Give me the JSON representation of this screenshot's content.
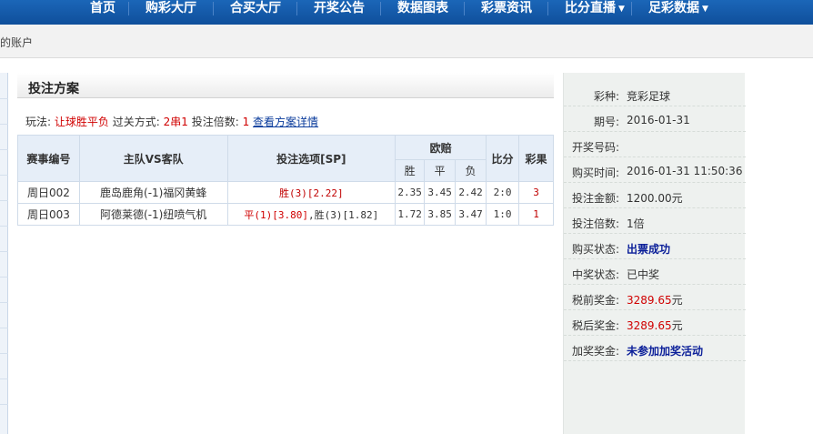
{
  "nav": {
    "items": [
      "首页",
      "购彩大厅",
      "合买大厅",
      "开奖公告",
      "数据图表",
      "彩票资讯",
      "比分直播",
      "足彩数据"
    ]
  },
  "breadcrumb": "的账户",
  "panel": {
    "title": "投注方案",
    "play_label": "玩法:",
    "play_value": "让球胜平负",
    "pass_label": "过关方式:",
    "pass_value": "2串1",
    "multiple_label": "投注倍数:",
    "multiple_value": "1",
    "detail_link": "查看方案详情"
  },
  "table": {
    "headers": {
      "match_no": "赛事编号",
      "teams": "主队VS客队",
      "option": "投注选项[SP]",
      "odds": "欧赔",
      "win": "胜",
      "draw": "平",
      "lose": "负",
      "score": "比分",
      "result": "彩果"
    },
    "rows": [
      {
        "match_no": "周日002",
        "teams": "鹿岛鹿角(-1)福冈黄蜂",
        "option": "胜(3)[2.22]",
        "win": "2.35",
        "draw": "3.45",
        "lose": "2.42",
        "score": "2:0",
        "result": "3"
      },
      {
        "match_no": "周日003",
        "teams": "阿德莱德(-1)纽喷气机",
        "option_a": "平(1)[3.80]",
        "option_b": ",胜(3)[1.82]",
        "win": "1.72",
        "draw": "3.85",
        "lose": "3.47",
        "score": "1:0",
        "result": "1"
      }
    ]
  },
  "info": {
    "lottery_label": "彩种:",
    "lottery_value": "竞彩足球",
    "issue_label": "期号:",
    "issue_value": "2016-01-31",
    "draw_no_label": "开奖号码:",
    "draw_no_value": "",
    "buy_time_label": "购买时间:",
    "buy_time_value": "2016-01-31 11:50:36",
    "amount_label": "投注金额:",
    "amount_value": "1200.00元",
    "multiple_label": "投注倍数:",
    "multiple_value": "1倍",
    "buy_status_label": "购买状态:",
    "buy_status_value": "出票成功",
    "prize_status_label": "中奖状态:",
    "prize_status_value": "已中奖",
    "pretax_label": "税前奖金:",
    "pretax_amount": "3289.65",
    "pretax_unit": "元",
    "aftertax_label": "税后奖金:",
    "aftertax_amount": "3289.65",
    "aftertax_unit": "元",
    "bonus_label": "加奖奖金:",
    "bonus_value": "未参加加奖活动"
  },
  "colors": {
    "nav_bg": "#1460b0",
    "accent_red": "#d00000",
    "link_blue": "#0b3c9c",
    "status_blue": "#0b1f99",
    "table_header_bg": "#e6eef8",
    "side_panel_bg": "#eef1ef"
  }
}
